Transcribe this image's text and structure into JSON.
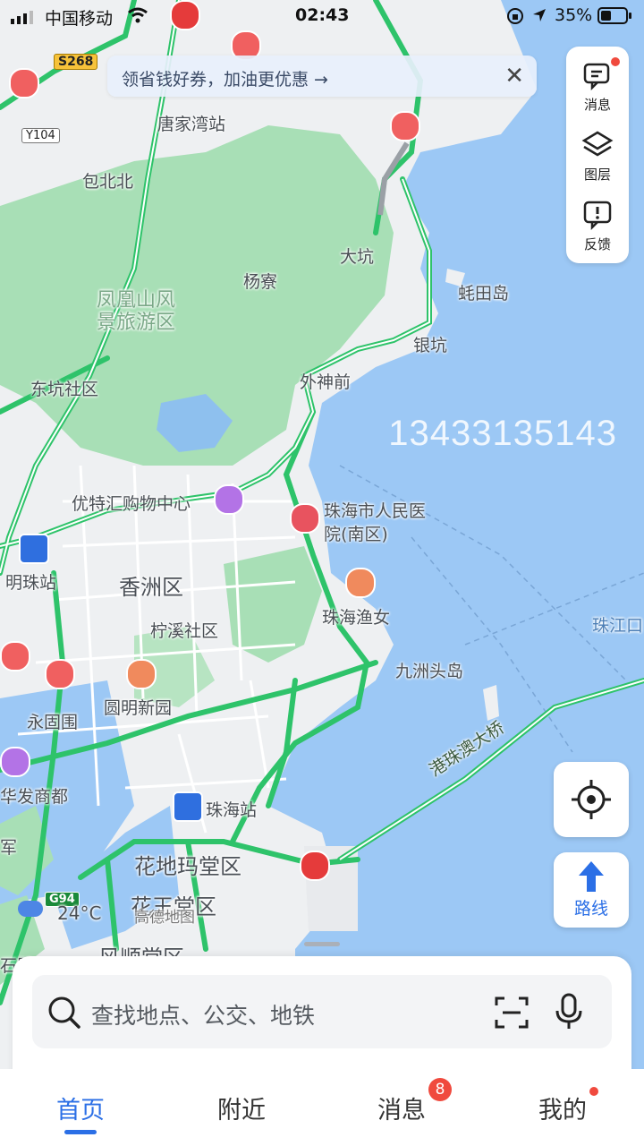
{
  "status_bar": {
    "carrier": "中国移动",
    "time": "02:43",
    "battery": "35%"
  },
  "banner": {
    "text": "领省钱好券，加油更优惠 →",
    "close": "✕"
  },
  "side_panel": {
    "messages": "消息",
    "layers": "图层",
    "feedback": "反馈"
  },
  "map": {
    "watermark_phone": "13433135143",
    "road_badges": {
      "s268": "S268",
      "y104": "Y104",
      "g94": "G94"
    },
    "labels": {
      "tangjiawan_station": "唐家湾站",
      "baobeibei": "包北北",
      "dakeng": "大坑",
      "yangzhai": "杨寮",
      "qitiandao": "蚝田岛",
      "fenghuangshan": "凤凰山风\n景旅游区",
      "yinkeng": "银坑",
      "dongkeng": "东坑社区",
      "waishenqian": "外神前",
      "youtehui": "优特汇购物中心",
      "hospital": "珠海市人民医\n院(南区)",
      "mingzhu_station": "明珠站",
      "xiangzhou": "香洲区",
      "zhuhai_yunv": "珠海渔女",
      "ningxi": "柠溪社区",
      "zhujiangkou": "珠江口",
      "jiuzhou_tou": "九洲头岛",
      "yuanming": "圆明新园",
      "yonggu": "永固围",
      "bridge": "港珠澳大桥",
      "huafa": "华发商都",
      "jun": "军",
      "zhuhai_station": "珠海站",
      "huadi_matang": "花地玛堂区",
      "huawangtang": "花王堂区",
      "fengshuntang": "风顺堂区",
      "shibi": "石壁"
    },
    "weather": "24°C",
    "map_provider": "高德地图"
  },
  "route_button": {
    "label": "路线"
  },
  "search": {
    "placeholder": "查找地点、公交、地铁"
  },
  "tabs": {
    "home": "首页",
    "nearby": "附近",
    "messages": "消息",
    "me": "我的"
  },
  "message_badge": "8",
  "colors": {
    "accent": "#2b6fe6",
    "road_green": "#2ec36a",
    "sea": "#9cc8f5",
    "park": "#a8dfb6",
    "land": "#eef0f2",
    "badge_red": "#f04a3e"
  }
}
